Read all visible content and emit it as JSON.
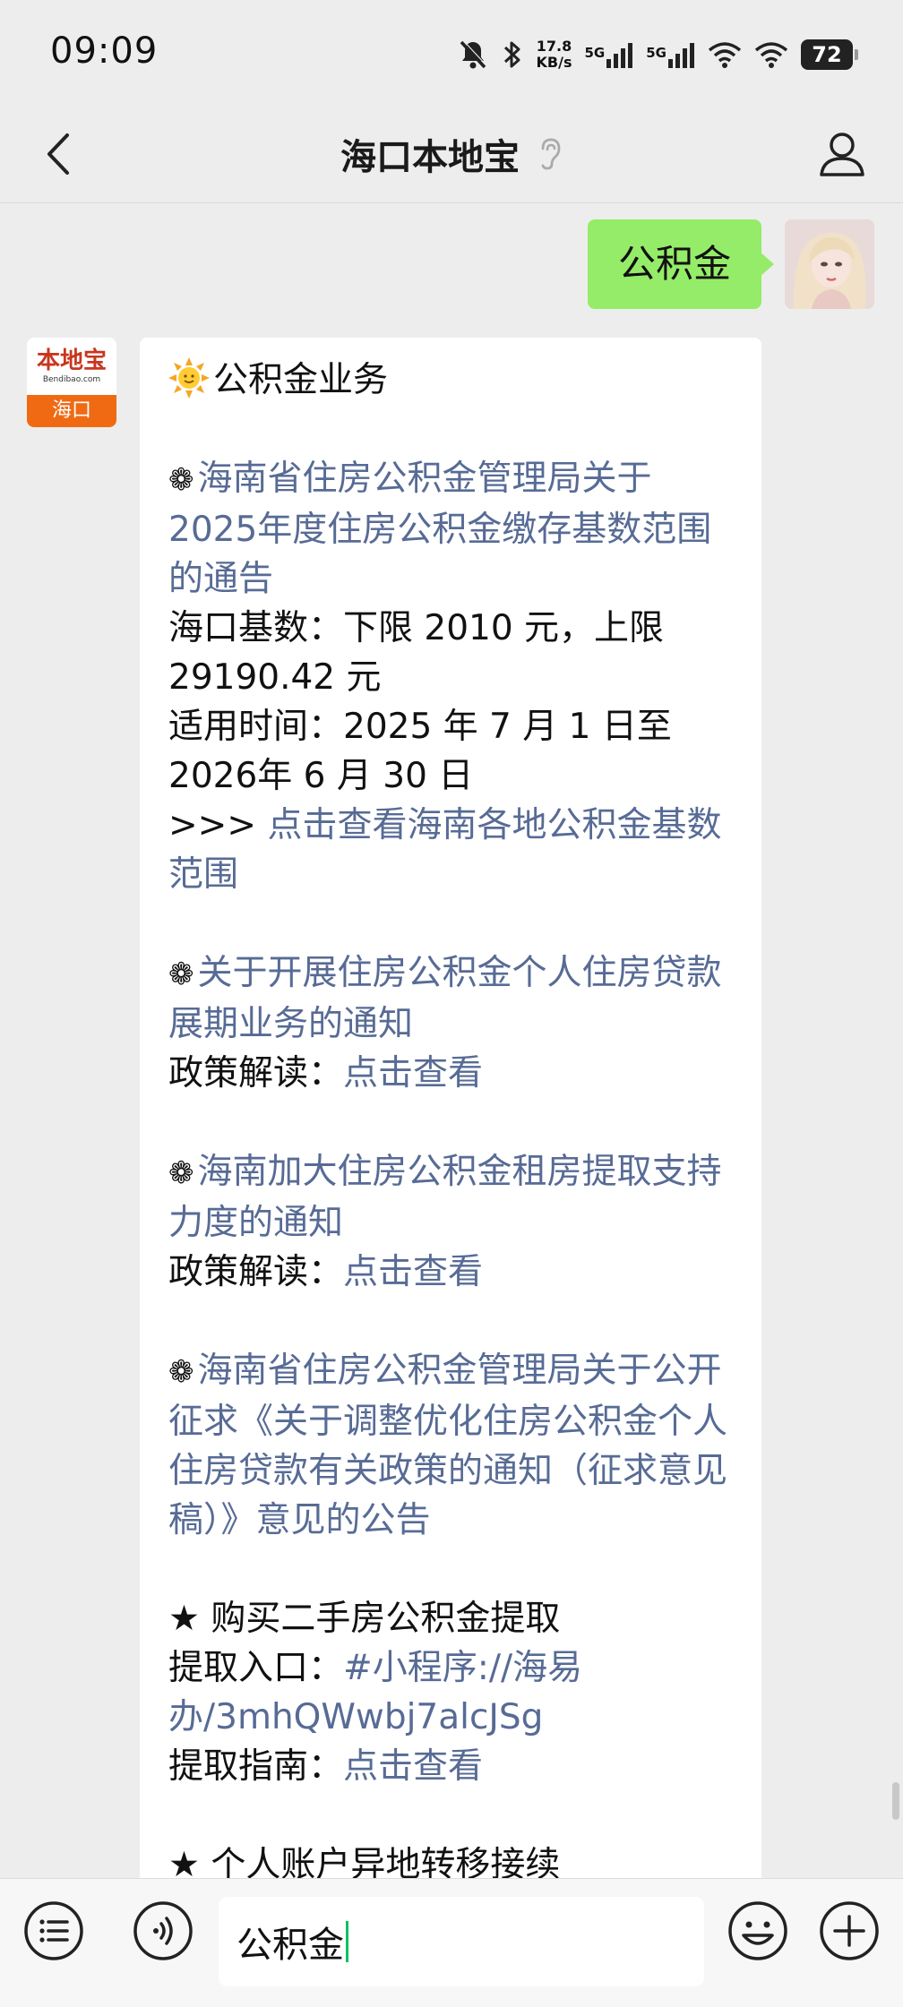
{
  "status_bar": {
    "time": "09:09",
    "net_speed_value": "17.8",
    "net_speed_unit": "KB/s",
    "signal1_label": "5G",
    "signal2_label": "5G",
    "battery": "72",
    "icons": [
      "mute-icon",
      "bluetooth-icon",
      "signal-icon",
      "signal-icon",
      "wifi-icon",
      "wifi-icon",
      "battery-icon"
    ]
  },
  "nav": {
    "title": "海口本地宝"
  },
  "sent_message": {
    "text": "公积金"
  },
  "bot_avatar": {
    "logo_text": "本地宝",
    "logo_url": "Bendibao.com",
    "city": "海口"
  },
  "reply": {
    "title": "公积金业务",
    "item1_link": "海南省住房公积金管理局关于2025年度住房公积金缴存基数范围的通告",
    "item1_base": "海口基数：下限 2010 元，上限 29190.42 元",
    "item1_time": "适用时间：2025 年 7 月 1 日至 2026年 6 月 30 日",
    "item1_more_prefix": ">>> ",
    "item1_more_link": "点击查看海南各地公积金基数范围",
    "item2_link": "关于开展住房公积金个人住房贷款展期业务的通知",
    "item2_label": "政策解读：",
    "item2_action": "点击查看",
    "item3_link": "海南加大住房公积金租房提取支持力度的通知",
    "item3_label": "政策解读：",
    "item3_action": "点击查看",
    "item4_link": "海南省住房公积金管理局关于公开征求《关于调整优化住房公积金个人住房贷款有关政策的通知（征求意见稿）》意见的公告",
    "item5_title": "★ 购买二手房公积金提取",
    "item5_entry_label": "提取入口：",
    "item5_entry_link": "#小程序://海易办/3mhQWwbj7alcJSg",
    "item5_guide_label": "提取指南：",
    "item5_guide_action": "点击查看",
    "item6_title": "★ 个人账户异地转移接续"
  },
  "input_bar": {
    "value": "公积金",
    "icons": [
      "menu-list-icon",
      "voice-icon",
      "emoji-icon",
      "plus-icon"
    ]
  },
  "colors": {
    "background": "#ededed",
    "sent_bubble": "#95ec69",
    "link": "#576b95",
    "caret": "#07c160",
    "bot_badge": "#f06a14"
  }
}
